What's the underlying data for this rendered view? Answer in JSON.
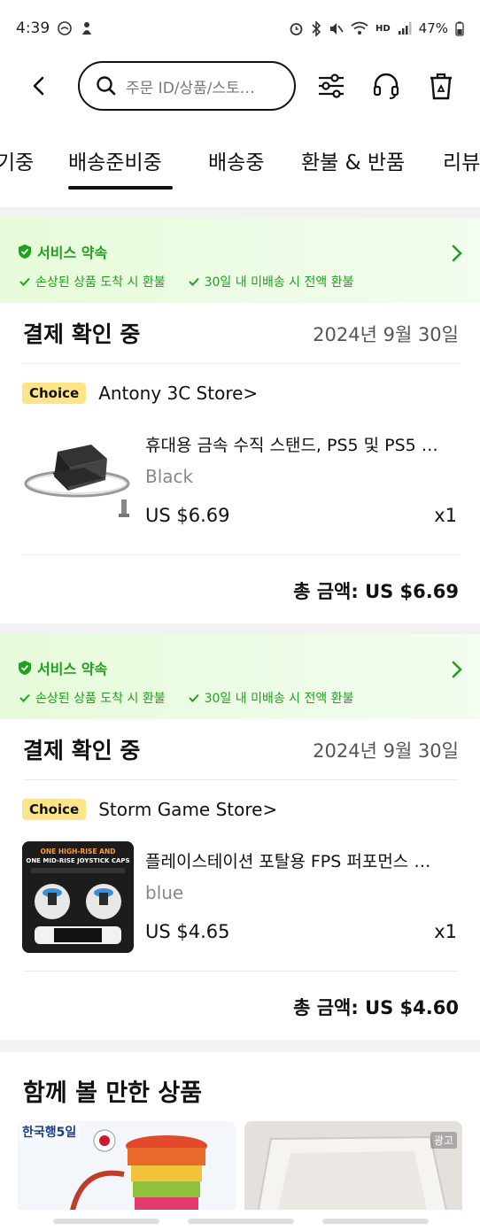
{
  "status_bar": {
    "time": "4:39",
    "battery": "47%",
    "hd_label": "HD"
  },
  "search": {
    "placeholder": "주문 ID/상품/스토…"
  },
  "tabs": [
    "기중",
    "배송준비중",
    "배송중",
    "환불 & 반품",
    "리뷰"
  ],
  "active_tab": "배송준비중",
  "orders": [
    {
      "promise_title": "서비스 약속",
      "promise_items": [
        "손상된 상품 도착 시 환불",
        "30일 내 미배송 시 전액 환불"
      ],
      "status": "결제 확인 중",
      "date": "2024년 9월 30일",
      "badge": "Choice",
      "store": "Antony 3C Store>",
      "product_title": "휴대용 금속 수직 스탠드, PS5 및 PS5 …",
      "variant": "Black",
      "price": "US $6.69",
      "qty": "x1",
      "total": "총 금액: US $6.69"
    },
    {
      "promise_title": "서비스 약속",
      "promise_items": [
        "손상된 상품 도착 시 환불",
        "30일 내 미배송 시 전액 환불"
      ],
      "status": "결제 확인 중",
      "date": "2024년 9월 30일",
      "badge": "Choice",
      "store": "Storm Game Store>",
      "product_title": "플레이스테이션 포탈용 FPS 퍼포먼스 …",
      "variant": "blue",
      "price": "US $4.65",
      "qty": "x1",
      "total": "총 금액: US $4.60",
      "image_text": [
        "ONE HIGH-RISE AND",
        "ONE MID-RISE JOYSTICK CAPS"
      ]
    }
  ],
  "recommend": {
    "title": "함께 볼 만한 상품",
    "cards": [
      {
        "banner": "한국행5일"
      },
      {
        "ad_label": "광고"
      }
    ]
  },
  "colors": {
    "accent_green": "#1ea21e",
    "choice_yellow": "#fde488"
  }
}
